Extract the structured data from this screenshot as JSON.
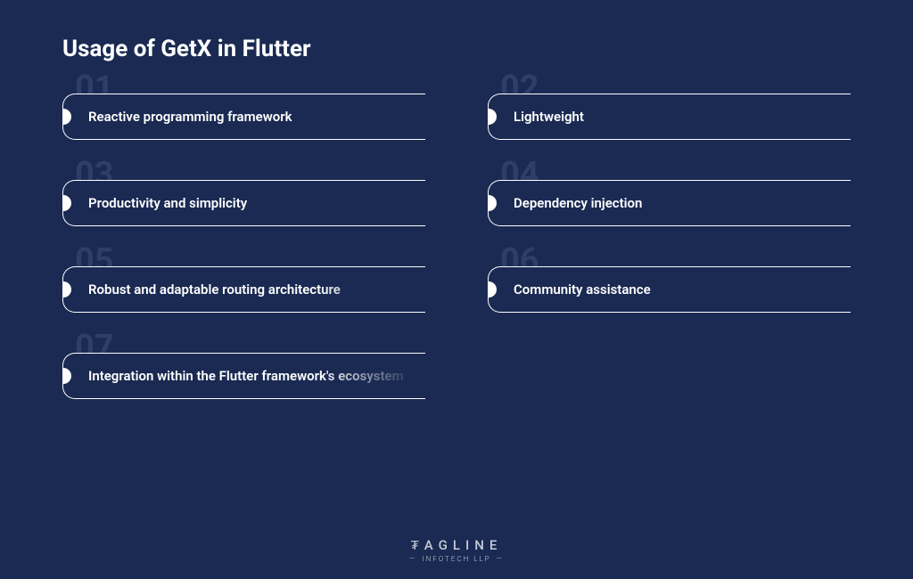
{
  "title": "Usage of GetX in Flutter",
  "items": [
    {
      "number": "01",
      "label": "Reactive programming framework"
    },
    {
      "number": "02",
      "label": "Lightweight"
    },
    {
      "number": "03",
      "label": "Productivity and simplicity"
    },
    {
      "number": "04",
      "label": "Dependency injection"
    },
    {
      "number": "05",
      "label": "Robust and adaptable routing architecture"
    },
    {
      "number": "06",
      "label": "Community assistance"
    },
    {
      "number": "07",
      "label": "Integration within the Flutter framework's ecosystem"
    }
  ],
  "logo": {
    "main": "₮AGLINE",
    "sub": "INFOTECH LLP"
  }
}
